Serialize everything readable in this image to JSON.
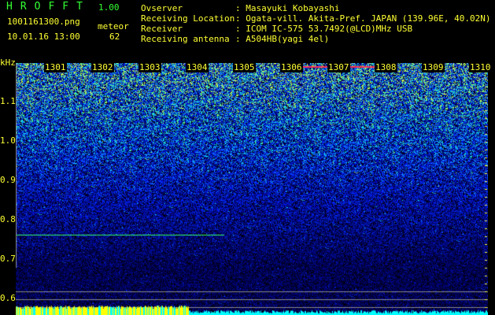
{
  "header": {
    "app_title": "HROFFT",
    "app_version": "1.00",
    "filename": "1001161300.png",
    "datetime": "10.01.16 13:00",
    "meteor_label": "meteor",
    "meteor_count": "62"
  },
  "info": [
    {
      "label": "Ovserver",
      "value": ": Masayuki Kobayashi"
    },
    {
      "label": "Receiving Location",
      "value": ": Ogata-vill. Akita-Pref. JAPAN (139.96E, 40.02N)"
    },
    {
      "label": "Receiver",
      "value": ": ICOM IC-575 53.7492(@LCD)MHz USB"
    },
    {
      "label": "Receiving antenna",
      "value": ": A504HB(yagi 4el)"
    }
  ],
  "plot": {
    "freq_unit": "kHz",
    "time_labels": [
      "1301",
      "1302",
      "1303",
      "1304",
      "1305",
      "1306",
      "1307",
      "1308",
      "1309",
      "1310"
    ],
    "freq_labels": [
      "1.1",
      "1.0",
      "0.9",
      "0.8",
      "0.7",
      "0.6"
    ],
    "colors": {
      "axis_text": "#ffff33",
      "grid": "#888888",
      "signal": "#33ff66",
      "bar_low": "#00ffff",
      "bar_high": "#ffff00"
    }
  }
}
